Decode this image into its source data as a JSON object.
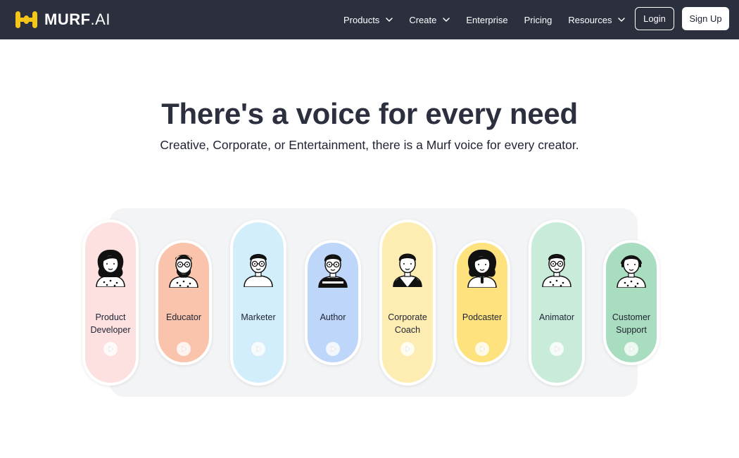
{
  "brand": {
    "name_bold": "MURF",
    "name_light": ".AI",
    "mark_color": "#f5c518"
  },
  "nav": {
    "items": [
      {
        "label": "Products",
        "has_dropdown": true
      },
      {
        "label": "Create",
        "has_dropdown": true
      },
      {
        "label": "Enterprise",
        "has_dropdown": false
      },
      {
        "label": "Pricing",
        "has_dropdown": false
      },
      {
        "label": "Resources",
        "has_dropdown": true
      }
    ],
    "login_label": "Login",
    "signup_label": "Sign Up"
  },
  "hero": {
    "title": "There's a voice for every need",
    "subtitle": "Creative, Corporate, or Entertainment, there is a Murf voice for every creator."
  },
  "voices": [
    {
      "line1": "Product",
      "line2": "Developer",
      "color": "#fde0e0",
      "icon": "woman-curly-hair-avatar-icon"
    },
    {
      "line1": "Educator",
      "line2": "",
      "color": "#f9c4ab",
      "icon": "bearded-man-glasses-avatar-icon"
    },
    {
      "line1": "Marketer",
      "line2": "",
      "color": "#d3eefb",
      "icon": "man-glasses-avatar-icon"
    },
    {
      "line1": "Author",
      "line2": "",
      "color": "#bed6f9",
      "icon": "man-glasses-striped-shirt-avatar-icon"
    },
    {
      "line1": "Corporate",
      "line2": "Coach",
      "color": "#fdedb2",
      "icon": "man-blazer-avatar-icon"
    },
    {
      "line1": "Podcaster",
      "line2": "",
      "color": "#fde27e",
      "icon": "woman-microphone-avatar-icon"
    },
    {
      "line1": "Animator",
      "line2": "",
      "color": "#c9ecda",
      "icon": "man-glasses-patterned-shirt-avatar-icon"
    },
    {
      "line1": "Customer",
      "line2": "Support",
      "color": "#a9ddbf",
      "icon": "woman-headset-avatar-icon"
    }
  ]
}
